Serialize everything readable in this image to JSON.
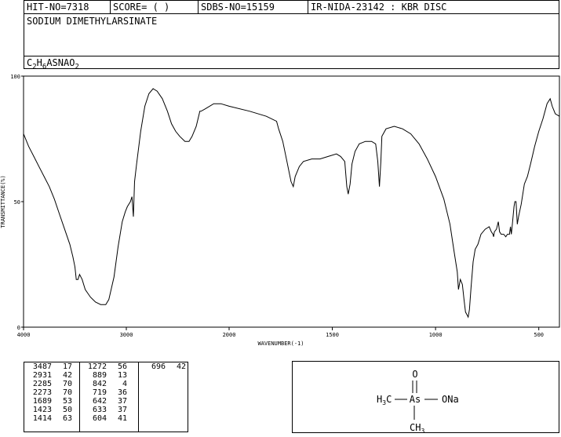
{
  "header": {
    "hit_no": "HIT-NO=7318",
    "score": "SCORE=  (   )",
    "sdbs_no": "SDBS-NO=15159",
    "ir": "IR-NIDA-23142 : KBR DISC",
    "compound_name": "SODIUM DIMETHYLARSINATE",
    "formula": {
      "c": "C",
      "c_n": "2",
      "h": "H",
      "h_n": "6",
      "rest": "ASNAO",
      "o_n": "2"
    }
  },
  "chart_data": {
    "type": "line",
    "xlabel": "WAVENUMBER(-1)",
    "ylabel": "TRANSMITTANCE(%)",
    "xlim": [
      4000,
      400
    ],
    "ylim": [
      0,
      100
    ],
    "x_ticks": [
      "4000",
      "3000",
      "2000",
      "1500",
      "1000",
      "500"
    ],
    "y_ticks": [
      "100",
      "50",
      "0"
    ],
    "series": [
      {
        "points": [
          [
            4000,
            77
          ],
          [
            3950,
            72
          ],
          [
            3900,
            68
          ],
          [
            3850,
            64
          ],
          [
            3800,
            60
          ],
          [
            3750,
            56
          ],
          [
            3700,
            51
          ],
          [
            3650,
            45
          ],
          [
            3600,
            39
          ],
          [
            3550,
            33
          ],
          [
            3520,
            28
          ],
          [
            3500,
            24
          ],
          [
            3487,
            19
          ],
          [
            3470,
            19
          ],
          [
            3455,
            21
          ],
          [
            3430,
            19
          ],
          [
            3400,
            15
          ],
          [
            3350,
            12
          ],
          [
            3300,
            10
          ],
          [
            3250,
            9
          ],
          [
            3200,
            9
          ],
          [
            3170,
            11
          ],
          [
            3120,
            20
          ],
          [
            3080,
            32
          ],
          [
            3040,
            42
          ],
          [
            3010,
            46
          ],
          [
            2990,
            48
          ],
          [
            2960,
            50
          ],
          [
            2945,
            52
          ],
          [
            2931,
            44
          ],
          [
            2920,
            58
          ],
          [
            2900,
            65
          ],
          [
            2860,
            78
          ],
          [
            2820,
            88
          ],
          [
            2780,
            93
          ],
          [
            2740,
            95
          ],
          [
            2700,
            94
          ],
          [
            2650,
            91
          ],
          [
            2600,
            86
          ],
          [
            2560,
            81
          ],
          [
            2520,
            78
          ],
          [
            2480,
            76
          ],
          [
            2430,
            74
          ],
          [
            2390,
            74
          ],
          [
            2360,
            76
          ],
          [
            2320,
            80
          ],
          [
            2285,
            86
          ],
          [
            2273,
            86
          ],
          [
            2230,
            87
          ],
          [
            2150,
            89
          ],
          [
            2080,
            89
          ],
          [
            2000,
            88
          ],
          [
            1900,
            86
          ],
          [
            1820,
            84
          ],
          [
            1770,
            82
          ],
          [
            1760,
            79
          ],
          [
            1740,
            74
          ],
          [
            1720,
            66
          ],
          [
            1700,
            58
          ],
          [
            1689,
            56
          ],
          [
            1680,
            60
          ],
          [
            1660,
            64
          ],
          [
            1640,
            66
          ],
          [
            1600,
            67
          ],
          [
            1560,
            67
          ],
          [
            1520,
            68
          ],
          [
            1480,
            69
          ],
          [
            1460,
            68
          ],
          [
            1440,
            66
          ],
          [
            1430,
            56
          ],
          [
            1423,
            53
          ],
          [
            1414,
            57
          ],
          [
            1405,
            65
          ],
          [
            1390,
            70
          ],
          [
            1370,
            73
          ],
          [
            1340,
            74
          ],
          [
            1310,
            74
          ],
          [
            1290,
            73
          ],
          [
            1280,
            66
          ],
          [
            1272,
            56
          ],
          [
            1265,
            66
          ],
          [
            1260,
            76
          ],
          [
            1240,
            79
          ],
          [
            1200,
            80
          ],
          [
            1160,
            79
          ],
          [
            1120,
            77
          ],
          [
            1080,
            73
          ],
          [
            1040,
            67
          ],
          [
            1000,
            60
          ],
          [
            960,
            51
          ],
          [
            930,
            41
          ],
          [
            910,
            30
          ],
          [
            895,
            22
          ],
          [
            889,
            15
          ],
          [
            880,
            19
          ],
          [
            870,
            17
          ],
          [
            862,
            11
          ],
          [
            855,
            6
          ],
          [
            848,
            5
          ],
          [
            842,
            4
          ],
          [
            836,
            7
          ],
          [
            828,
            16
          ],
          [
            818,
            26
          ],
          [
            808,
            31
          ],
          [
            795,
            33
          ],
          [
            780,
            37
          ],
          [
            760,
            39
          ],
          [
            740,
            40
          ],
          [
            730,
            38
          ],
          [
            722,
            37
          ],
          [
            719,
            36
          ],
          [
            715,
            38
          ],
          [
            705,
            39
          ],
          [
            696,
            42
          ],
          [
            690,
            38
          ],
          [
            682,
            37
          ],
          [
            670,
            37
          ],
          [
            660,
            36
          ],
          [
            652,
            37
          ],
          [
            642,
            37
          ],
          [
            637,
            40
          ],
          [
            633,
            37
          ],
          [
            628,
            41
          ],
          [
            620,
            48
          ],
          [
            616,
            50
          ],
          [
            610,
            50
          ],
          [
            604,
            41
          ],
          [
            598,
            44
          ],
          [
            585,
            49
          ],
          [
            570,
            57
          ],
          [
            555,
            60
          ],
          [
            540,
            65
          ],
          [
            520,
            72
          ],
          [
            500,
            78
          ],
          [
            480,
            83
          ],
          [
            460,
            89
          ],
          [
            445,
            91
          ],
          [
            435,
            88
          ],
          [
            420,
            85
          ],
          [
            400,
            84
          ]
        ]
      }
    ]
  },
  "peak_table": {
    "columns": [
      [
        [
          "3487",
          "17"
        ],
        [
          "2931",
          "42"
        ],
        [
          "2285",
          "70"
        ],
        [
          "2273",
          "70"
        ],
        [
          "1689",
          "53"
        ],
        [
          "1423",
          "50"
        ],
        [
          "1414",
          "63"
        ]
      ],
      [
        [
          "1272",
          "56"
        ],
        [
          "889",
          "13"
        ],
        [
          "842",
          "4"
        ],
        [
          "719",
          "36"
        ],
        [
          "642",
          "37"
        ],
        [
          "633",
          "37"
        ],
        [
          "604",
          "41"
        ]
      ],
      [
        [
          "696",
          "42"
        ]
      ]
    ]
  },
  "structure": {
    "o": "O",
    "as": "As",
    "ona": "ONa",
    "h3c_h": "H",
    "h3c_n": "3",
    "h3c_c": "C",
    "ch3_c": "CH",
    "ch3_n": "3"
  }
}
